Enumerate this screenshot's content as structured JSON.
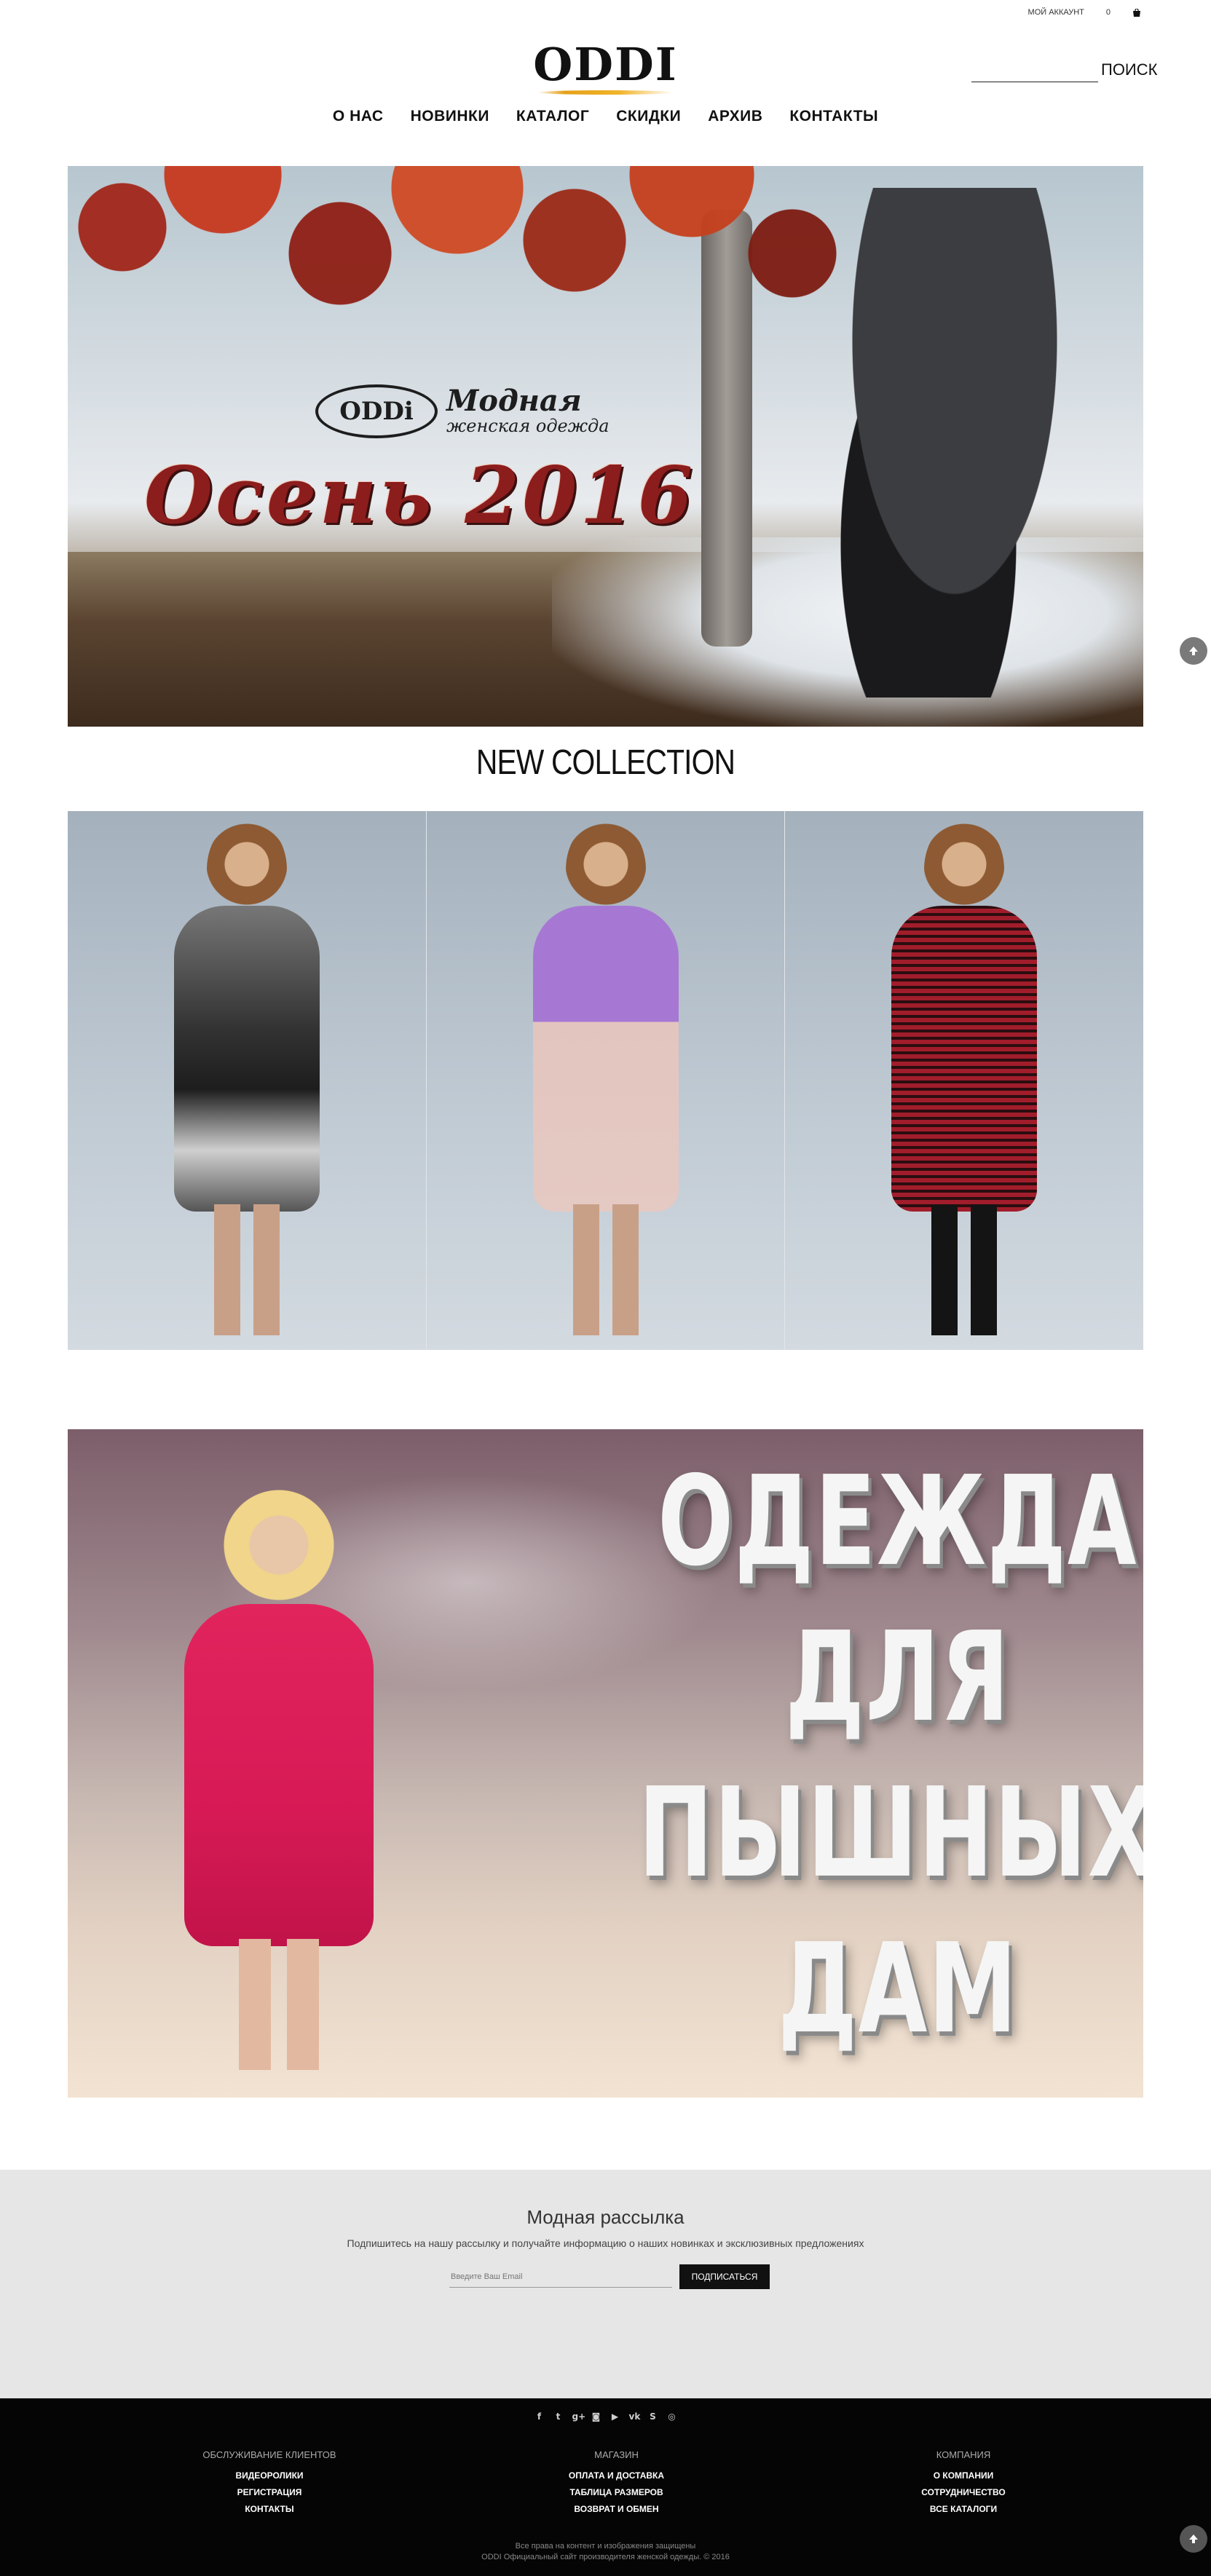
{
  "topbar": {
    "account_label": "мой аккаунт",
    "cart_count": "0",
    "cart_icon": "shopping-bag-icon"
  },
  "header": {
    "logo_text": "ODDI",
    "search_label": "ПОИСК",
    "search_placeholder": ""
  },
  "nav": {
    "items": [
      {
        "label": "О НАС"
      },
      {
        "label": "НОВИНКИ"
      },
      {
        "label": "КАТАЛОГ"
      },
      {
        "label": "СКИДКИ"
      },
      {
        "label": "АРХИВ"
      },
      {
        "label": "КОНТАКТЫ"
      }
    ]
  },
  "hero": {
    "logo_text": "ODDi",
    "tagline_1": "Модная",
    "tagline_2": "женская одежда",
    "season": "Осень 2016"
  },
  "collection": {
    "title": "NEW COLLECTION"
  },
  "plus_banner": {
    "lines": [
      "ОДЕЖДА",
      "ДЛЯ",
      "ПЫШНЫХ",
      "ДАМ"
    ]
  },
  "newsletter": {
    "title": "Модная рассылка",
    "subtitle": "Подпишитесь на нашу рассылку и получайте информацию о наших новинках и эксклюзивных предложениях",
    "email_placeholder": "Введите Ваш Email",
    "button_label": "ПОДПИСАТЬСЯ"
  },
  "footer": {
    "social_icons": [
      "facebook-icon",
      "twitter-icon",
      "google-plus-icon",
      "instagram-icon",
      "youtube-icon",
      "vk-icon",
      "skype-icon",
      "odnoklassniki-icon"
    ],
    "columns": [
      {
        "title": "ОБСЛУЖИВАНИЕ КЛИЕНТОВ",
        "links": [
          "ВИДЕОРОЛИКИ",
          "РЕГИСТРАЦИЯ",
          "КОНТАКТЫ"
        ]
      },
      {
        "title": "МАГАЗИН",
        "links": [
          "ОПЛАТА И ДОСТАВКА",
          "ТАБЛИЦА РАЗМЕРОВ",
          "ВОЗВРАТ И ОБМЕН"
        ]
      },
      {
        "title": "КОМПАНИЯ",
        "links": [
          "О КОМПАНИИ",
          "СОТРУДНИЧЕСТВО",
          "ВСЕ КАТАЛОГИ"
        ]
      }
    ],
    "copyright_1": "Все права на контент и изображения защищены",
    "copyright_2": "ODDI Официальный сайт производителя женской одежды. © 2016"
  },
  "colors": {
    "footer_bg": "#050505",
    "newsletter_bg": "#e6e6e6",
    "button_bg": "#111111",
    "accent_gold": "#f1b52b"
  }
}
